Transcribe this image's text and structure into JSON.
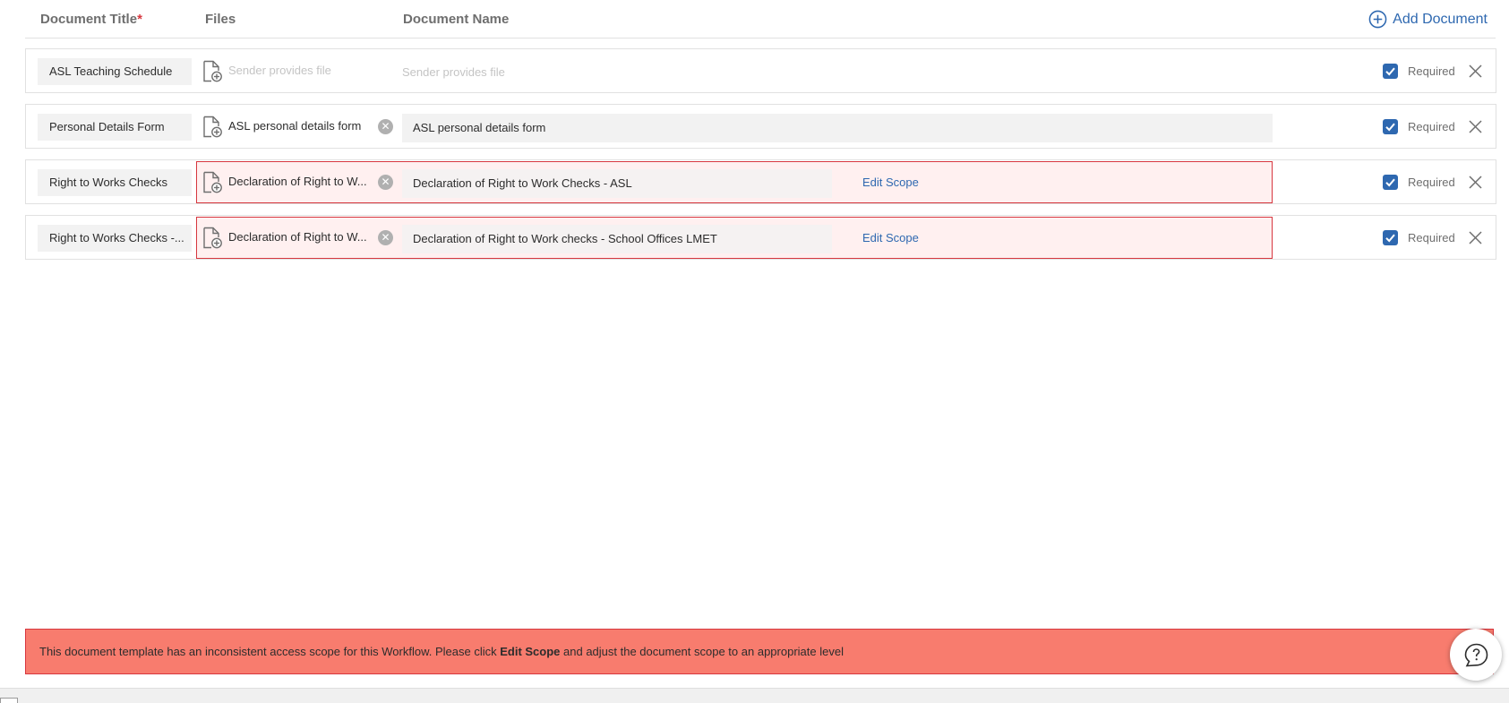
{
  "header": {
    "document_title": "Document Title",
    "required_marker": "*",
    "files": "Files",
    "document_name": "Document Name",
    "add_document": "Add Document"
  },
  "rows": [
    {
      "title": "ASL Teaching Schedule",
      "file": "Sender provides file",
      "document_name": "Sender provides file",
      "required_label": "Required",
      "required_checked": true
    },
    {
      "title": "Personal Details Form",
      "file": "ASL personal details form",
      "document_name": "ASL personal details form",
      "required_label": "Required",
      "required_checked": true
    },
    {
      "title": "Right to Works Checks",
      "file": "Declaration of Right to W...",
      "document_name": "Declaration of Right to Work Checks - ASL",
      "edit_scope": "Edit Scope",
      "required_label": "Required",
      "required_checked": true,
      "has_error": true
    },
    {
      "title": "Right to Works Checks -...",
      "file": "Declaration of Right to W...",
      "document_name": "Declaration of Right to Work checks - School Offices LMET",
      "edit_scope": "Edit Scope",
      "required_label": "Required",
      "required_checked": true,
      "has_error": true
    }
  ],
  "error_banner": {
    "text_before": "This document template has an inconsistent access scope for this Workflow. Please click ",
    "bold": "Edit Scope",
    "text_after": " and adjust the document scope to an appropriate level"
  },
  "icons": {
    "add": "plus-circle-icon",
    "file": "file-add-icon",
    "clear": "clear-circle-icon",
    "checkbox": "checkmark-icon",
    "remove": "close-icon",
    "help": "help-chat-icon"
  },
  "colors": {
    "accent": "#2e68b0",
    "error_border": "#d7373f",
    "error_row_bg": "#fff0f0",
    "error_banner_bg": "#f87c6e"
  }
}
